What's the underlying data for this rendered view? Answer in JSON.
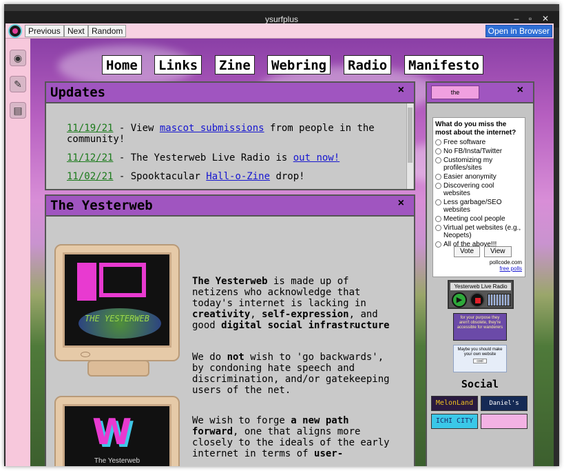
{
  "window": {
    "title": "ysurfplus",
    "controls": [
      "minimize-icon",
      "maximize-icon",
      "close-icon"
    ]
  },
  "toolbar": {
    "previous_label": "Previous",
    "next_label": "Next",
    "random_label": "Random",
    "open_label": "Open in Browser"
  },
  "dock": {
    "icons": [
      "globe-icon",
      "tools-icon",
      "radio-icon"
    ]
  },
  "nav": [
    "Home",
    "Links",
    "Zine",
    "Webring",
    "Radio",
    "Manifesto"
  ],
  "updates": {
    "title": "Updates",
    "close": "×",
    "items": [
      {
        "date": "11/19/21",
        "pre": " - View ",
        "link": "mascot submissions",
        "post": " from people in the",
        "cont": "community!"
      },
      {
        "date": "11/12/21",
        "pre": " - The Yesterweb Live Radio is ",
        "link": "out now!",
        "post": ""
      },
      {
        "date": "11/02/21",
        "pre": " - Spooktacular ",
        "link": "Hall-o-Zine",
        "post": " drop!"
      }
    ]
  },
  "yesterweb": {
    "title": "The Yesterweb",
    "close": "×",
    "crt_label": "THE YESTERWEB",
    "crt2_label": "The Yesterweb",
    "p1": {
      "bold1": "The Yesterweb",
      "t1": " is made up of netizens who acknowledge that today's internet is lacking in ",
      "bold2": "creativity",
      "t2": ", ",
      "bold3": "self-expression",
      "t3": ", and good ",
      "bold4": "digital social infrastructure"
    },
    "p2": {
      "t1": "We do ",
      "bold1": "not",
      "t2": " wish to 'go backwards', by condoning hate speech and discrimination, and/or gatekeeping users of the net."
    },
    "p3": {
      "t1": "We wish to forge ",
      "bold1": "a new path forward",
      "t2": ", one that aligns more closely to the ideals of the early internet in terms of ",
      "bold2": "user-"
    }
  },
  "sidebar": {
    "mascot_label": "the",
    "close": "×",
    "poll": {
      "question": "What do you miss the most about the internet?",
      "options": [
        "Free software",
        "No FB/Insta/Twitter",
        "Customizing my profiles/sites",
        "Easier anonymity",
        "Discovering cool websites",
        "Less garbage/SEO websites",
        "Meeting cool people",
        "Virtual pet websites (e.g., Neopets)",
        "All of the above!!!"
      ],
      "vote_label": "Vote",
      "view_label": "View",
      "credit": "pollcode.com",
      "free_polls": "free polls"
    },
    "radio_label": "Yesterweb Live Radio",
    "banner1_text": "for your purpose they aren't obsolete, they're accessible for wanderers",
    "banner2_text": "Maybe you should make your own website",
    "banner2_btn": "cool",
    "social_title": "Social",
    "social_badges": [
      "MelonLand",
      "Daniel's Network",
      "ICHI CITY",
      ""
    ]
  },
  "colors": {
    "accent_purple": "#a055c0",
    "pink_chrome": "#f7d2e2",
    "date_green": "#1a7a1a",
    "link_blue": "#1515d0"
  }
}
